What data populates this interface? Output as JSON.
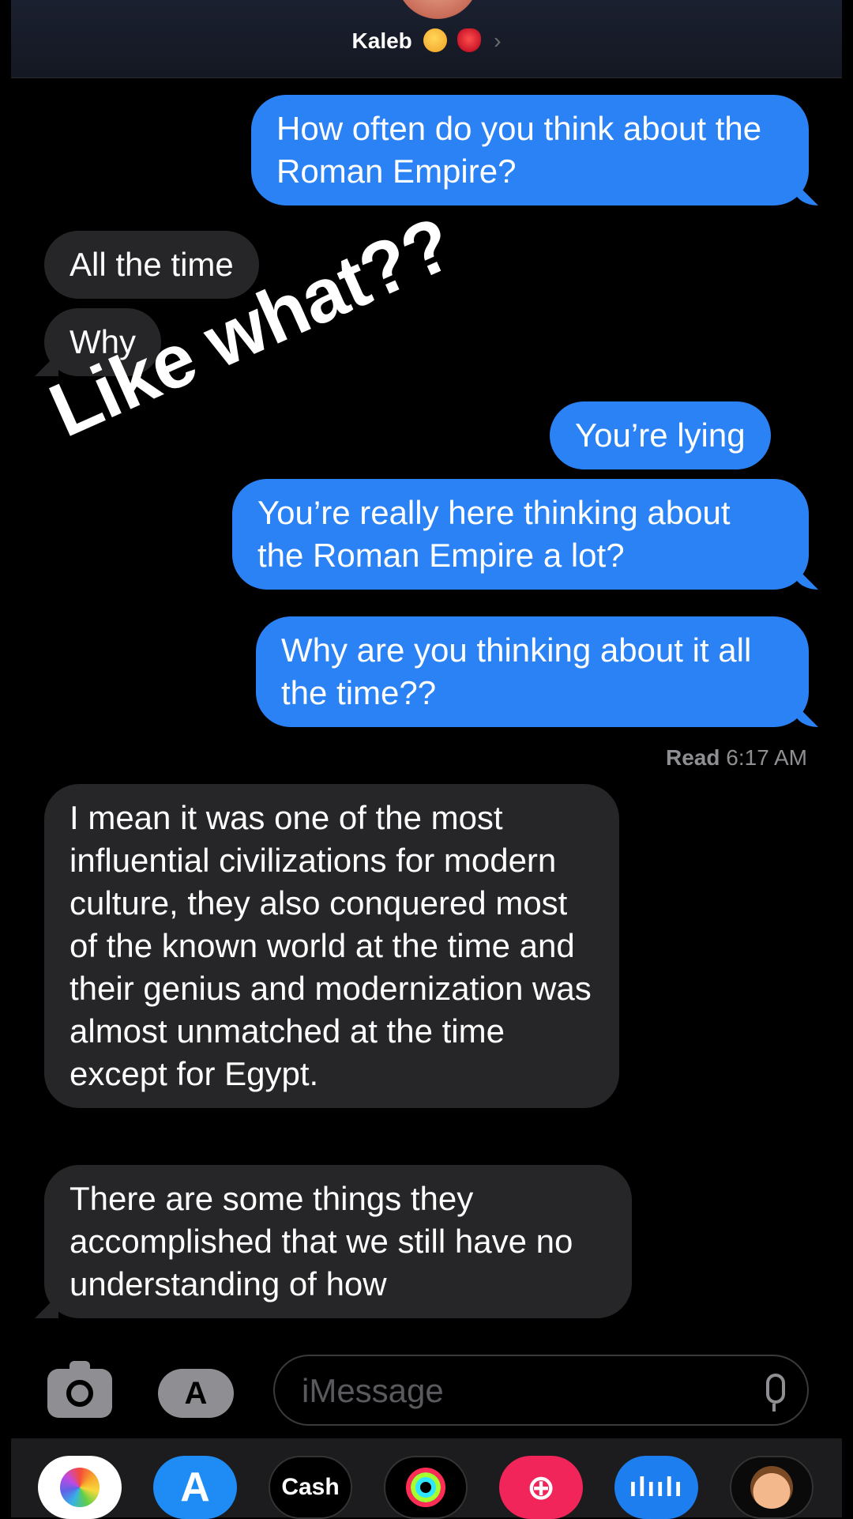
{
  "header": {
    "contact_name": "Kaleb",
    "chevron": "›"
  },
  "messages": [
    {
      "id": "m1",
      "direction": "outgoing",
      "text": "How often do you think about the Roman Empire?"
    },
    {
      "id": "m2",
      "direction": "incoming",
      "text": "All the time"
    },
    {
      "id": "m3",
      "direction": "incoming",
      "text": "Why"
    },
    {
      "id": "m4",
      "direction": "outgoing",
      "text": "You’re lying"
    },
    {
      "id": "m5",
      "direction": "outgoing",
      "text": "You’re really here thinking about the Roman Empire a lot?"
    },
    {
      "id": "m6",
      "direction": "outgoing",
      "text": "Why are you thinking about it all the time??"
    },
    {
      "id": "m7",
      "direction": "incoming",
      "text": "I mean it was one of the most influential civilizations for modern culture, they also conquered most of the known world at the time and their genius and modernization was almost unmatched at the time except for Egypt."
    },
    {
      "id": "m8",
      "direction": "incoming",
      "text": "There are some things they accomplished that we still have no understanding of how"
    }
  ],
  "read_receipt": {
    "label": "Read",
    "time": "6:17 AM"
  },
  "overlay_caption": "Like what??",
  "composer": {
    "placeholder": "iMessage"
  },
  "dock": {
    "apps": [
      {
        "name": "photos",
        "label": ""
      },
      {
        "name": "app-store",
        "label": "A"
      },
      {
        "name": "cash",
        "label": "Cash"
      },
      {
        "name": "fitness",
        "label": ""
      },
      {
        "name": "search",
        "label": "⊕"
      },
      {
        "name": "audio",
        "label": "ılıılı"
      },
      {
        "name": "memoji",
        "label": ""
      }
    ]
  },
  "colors": {
    "outgoing_bubble": "#2b82f5",
    "incoming_bubble": "#262628",
    "background": "#000000"
  }
}
